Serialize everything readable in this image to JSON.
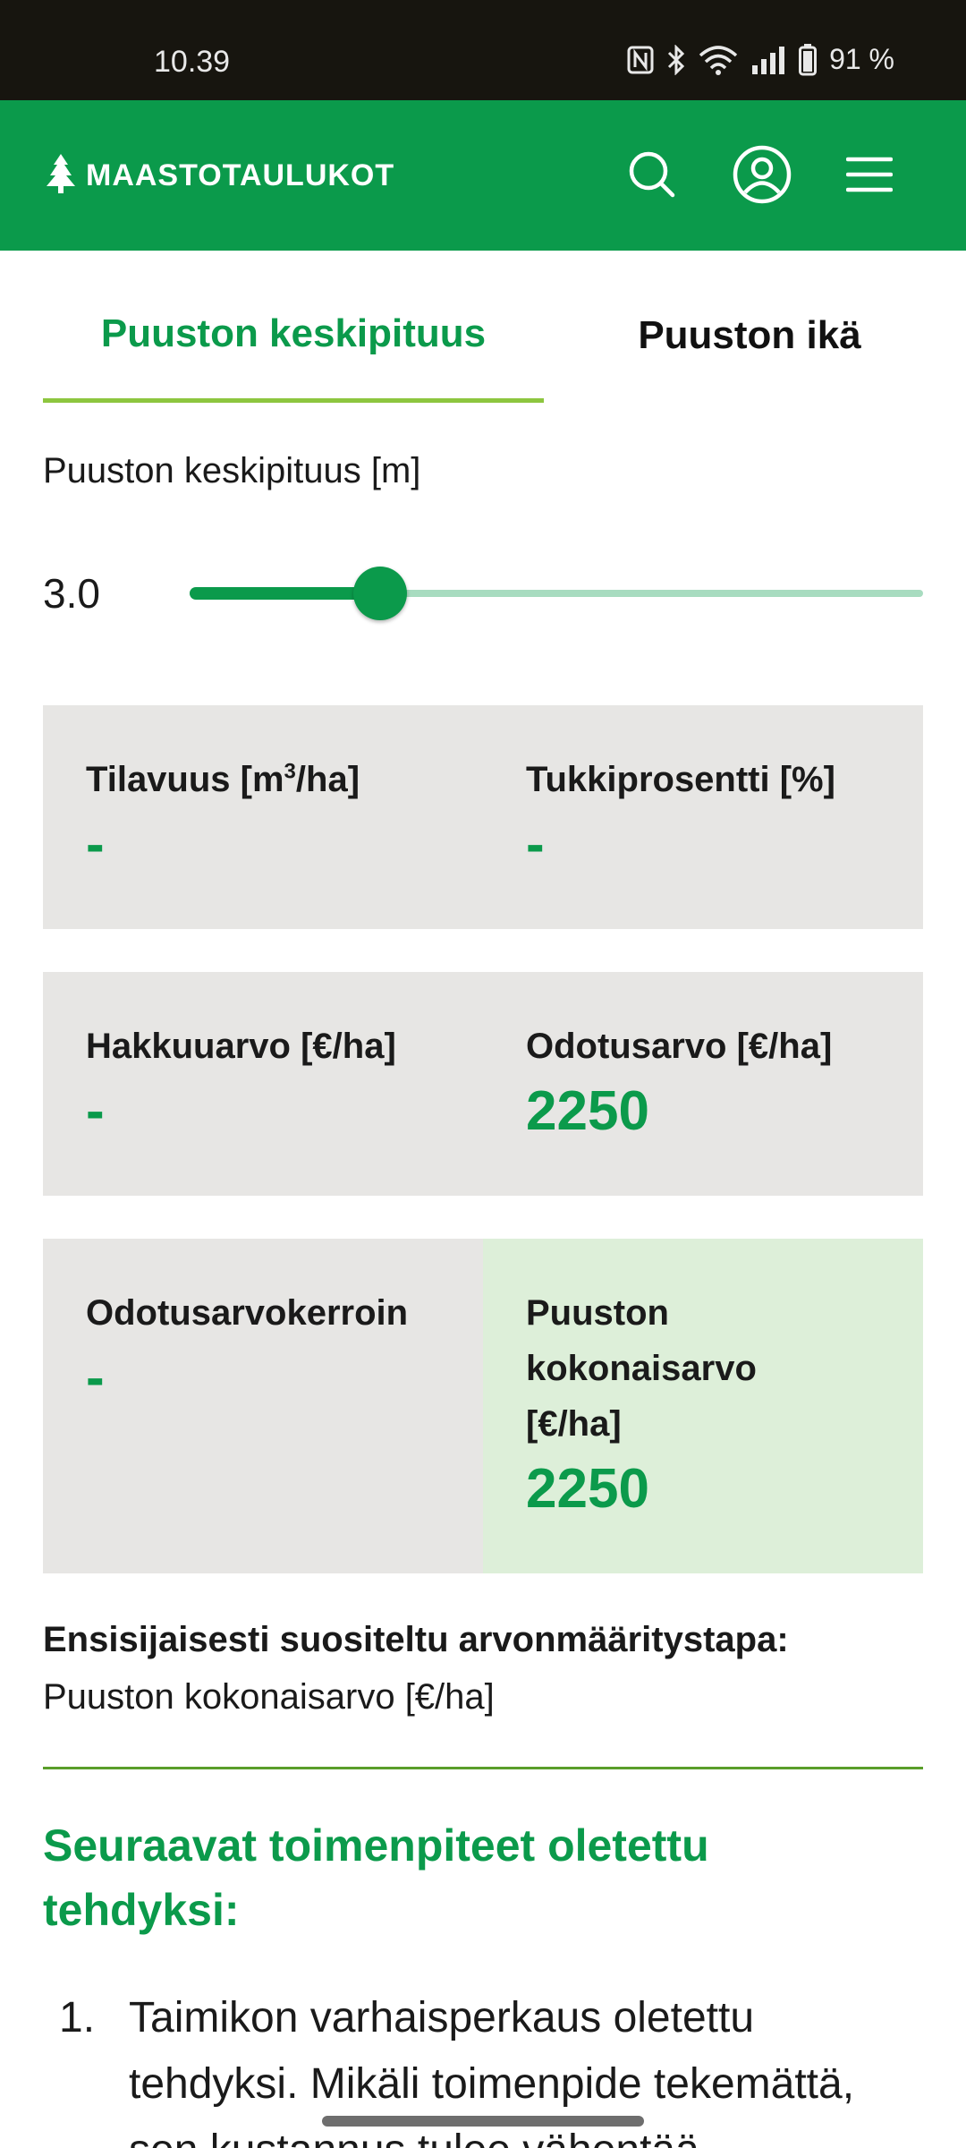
{
  "status_bar": {
    "time": "10.39",
    "battery": "91 %"
  },
  "header": {
    "logo_text": "MAASTOTAULUKOT",
    "brand_color": "#0b9a4b"
  },
  "tabs": [
    {
      "label": "Puuston keskipituus",
      "active": true
    },
    {
      "label": "Puuston ikä",
      "active": false
    }
  ],
  "slider": {
    "label": "Puuston keskipituus [m]",
    "value_text": "3.0",
    "fraction": 0.26
  },
  "cards": {
    "tilavuus": {
      "label_prefix": "Tilavuus [m",
      "label_sup": "3",
      "label_suffix": "/ha]",
      "value": "-"
    },
    "tukkiprosentti": {
      "label": "Tukkiprosentti [%]",
      "value": "-"
    },
    "hakkuuarvo": {
      "label": "Hakkuuarvo [€/ha]",
      "value": "-"
    },
    "odotusarvo": {
      "label": "Odotusarvo [€/ha]",
      "value": "2250"
    },
    "odotusarvokerroin": {
      "label": "Odotusarvokerroin",
      "value": "-"
    },
    "kokonaisarvo": {
      "label_lines": [
        "Puuston",
        "kokonaisarvo",
        "[€/ha]"
      ],
      "value": "2250"
    }
  },
  "recommendation": {
    "title": "Ensisijaisesti suositeltu arvonmääritystapa:",
    "value": "Puuston kokonaisarvo [€/ha]"
  },
  "next_actions": {
    "title": "Seuraavat toimenpiteet oletettu tehdyksi:",
    "items": [
      {
        "num": "1.",
        "text": "Taimikon varhaisperkaus oletettu tehdyksi. Mikäli toimenpide tekemättä, sen kustannus tulee vähentää"
      }
    ]
  }
}
